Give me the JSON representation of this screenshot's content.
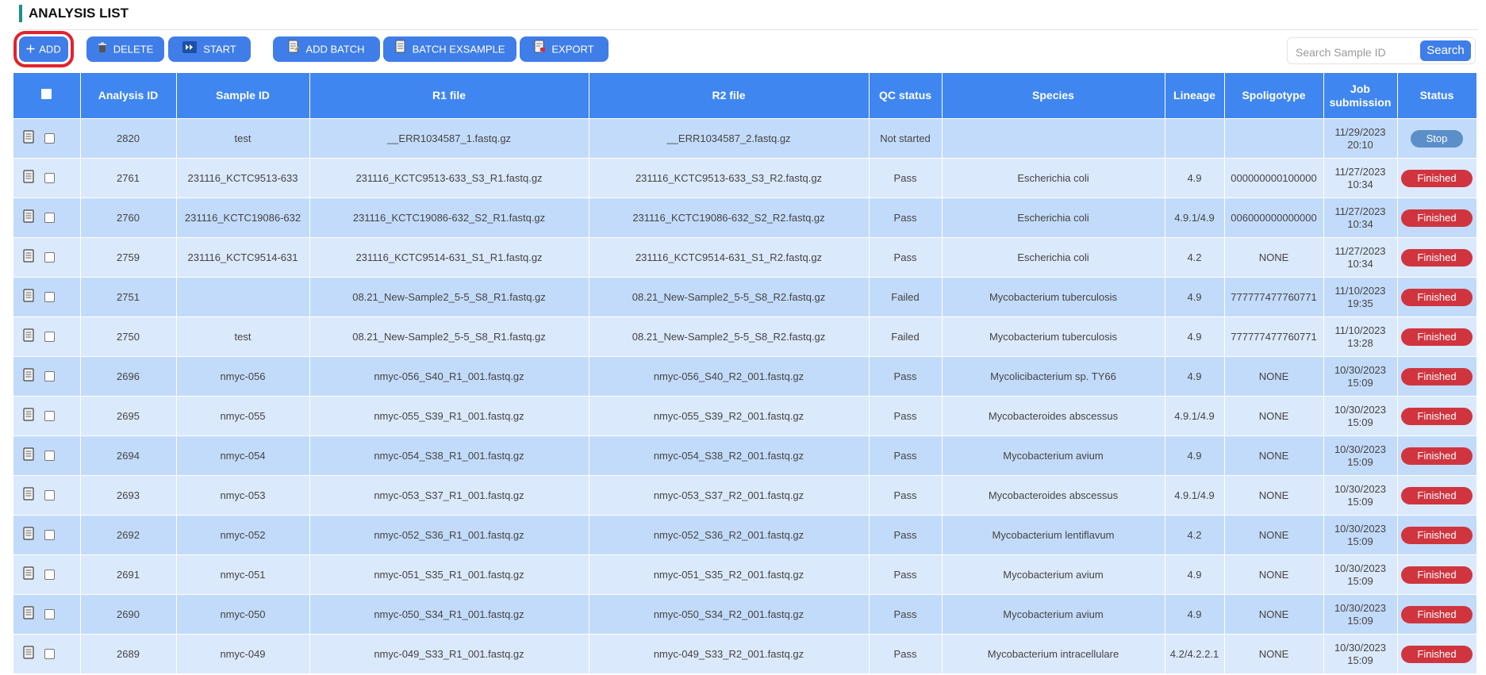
{
  "header": {
    "title": "ANALYSIS LIST"
  },
  "toolbar": {
    "add": "ADD",
    "delete": "DELETE",
    "start": "START",
    "add_batch": "ADD BATCH",
    "batch_example": "BATCH EXSAMPLE",
    "export": "EXPORT"
  },
  "search": {
    "placeholder": "Search Sample ID",
    "button": "Search"
  },
  "table": {
    "columns": [
      "Analysis ID",
      "Sample ID",
      "R1 file",
      "R2 file",
      "QC status",
      "Species",
      "Lineage",
      "Spoligotype",
      "Job submission",
      "Status"
    ],
    "rows": [
      {
        "id": "2820",
        "sample": "test",
        "r1": "__ERR1034587_1.fastq.gz",
        "r2": "__ERR1034587_2.fastq.gz",
        "qc": "Not started",
        "species": "",
        "lineage": "",
        "spoligo": "",
        "date": "11/29/2023",
        "time": "20:10",
        "status": "Stop"
      },
      {
        "id": "2761",
        "sample": "231116_KCTC9513-633",
        "r1": "231116_KCTC9513-633_S3_R1.fastq.gz",
        "r2": "231116_KCTC9513-633_S3_R2.fastq.gz",
        "qc": "Pass",
        "species": "Escherichia coli",
        "lineage": "4.9",
        "spoligo": "000000000100000",
        "date": "11/27/2023",
        "time": "10:34",
        "status": "Finished"
      },
      {
        "id": "2760",
        "sample": "231116_KCTC19086-632",
        "r1": "231116_KCTC19086-632_S2_R1.fastq.gz",
        "r2": "231116_KCTC19086-632_S2_R2.fastq.gz",
        "qc": "Pass",
        "species": "Escherichia coli",
        "lineage": "4.9.1/4.9",
        "spoligo": "006000000000000",
        "date": "11/27/2023",
        "time": "10:34",
        "status": "Finished"
      },
      {
        "id": "2759",
        "sample": "231116_KCTC9514-631",
        "r1": "231116_KCTC9514-631_S1_R1.fastq.gz",
        "r2": "231116_KCTC9514-631_S1_R2.fastq.gz",
        "qc": "Pass",
        "species": "Escherichia coli",
        "lineage": "4.2",
        "spoligo": "NONE",
        "date": "11/27/2023",
        "time": "10:34",
        "status": "Finished"
      },
      {
        "id": "2751",
        "sample": "",
        "r1": "08.21_New-Sample2_5-5_S8_R1.fastq.gz",
        "r2": "08.21_New-Sample2_5-5_S8_R2.fastq.gz",
        "qc": "Failed",
        "species": "Mycobacterium tuberculosis",
        "lineage": "4.9",
        "spoligo": "777777477760771",
        "date": "11/10/2023",
        "time": "19:35",
        "status": "Finished"
      },
      {
        "id": "2750",
        "sample": "test",
        "r1": "08.21_New-Sample2_5-5_S8_R1.fastq.gz",
        "r2": "08.21_New-Sample2_5-5_S8_R2.fastq.gz",
        "qc": "Failed",
        "species": "Mycobacterium tuberculosis",
        "lineage": "4.9",
        "spoligo": "777777477760771",
        "date": "11/10/2023",
        "time": "13:28",
        "status": "Finished"
      },
      {
        "id": "2696",
        "sample": "nmyc-056",
        "r1": "nmyc-056_S40_R1_001.fastq.gz",
        "r2": "nmyc-056_S40_R2_001.fastq.gz",
        "qc": "Pass",
        "species": "Mycolicibacterium sp. TY66",
        "lineage": "4.9",
        "spoligo": "NONE",
        "date": "10/30/2023",
        "time": "15:09",
        "status": "Finished"
      },
      {
        "id": "2695",
        "sample": "nmyc-055",
        "r1": "nmyc-055_S39_R1_001.fastq.gz",
        "r2": "nmyc-055_S39_R2_001.fastq.gz",
        "qc": "Pass",
        "species": "Mycobacteroides abscessus",
        "lineage": "4.9.1/4.9",
        "spoligo": "NONE",
        "date": "10/30/2023",
        "time": "15:09",
        "status": "Finished"
      },
      {
        "id": "2694",
        "sample": "nmyc-054",
        "r1": "nmyc-054_S38_R1_001.fastq.gz",
        "r2": "nmyc-054_S38_R2_001.fastq.gz",
        "qc": "Pass",
        "species": "Mycobacterium avium",
        "lineage": "4.9",
        "spoligo": "NONE",
        "date": "10/30/2023",
        "time": "15:09",
        "status": "Finished"
      },
      {
        "id": "2693",
        "sample": "nmyc-053",
        "r1": "nmyc-053_S37_R1_001.fastq.gz",
        "r2": "nmyc-053_S37_R2_001.fastq.gz",
        "qc": "Pass",
        "species": "Mycobacteroides abscessus",
        "lineage": "4.9.1/4.9",
        "spoligo": "NONE",
        "date": "10/30/2023",
        "time": "15:09",
        "status": "Finished"
      },
      {
        "id": "2692",
        "sample": "nmyc-052",
        "r1": "nmyc-052_S36_R1_001.fastq.gz",
        "r2": "nmyc-052_S36_R2_001.fastq.gz",
        "qc": "Pass",
        "species": "Mycobacterium lentiflavum",
        "lineage": "4.2",
        "spoligo": "NONE",
        "date": "10/30/2023",
        "time": "15:09",
        "status": "Finished"
      },
      {
        "id": "2691",
        "sample": "nmyc-051",
        "r1": "nmyc-051_S35_R1_001.fastq.gz",
        "r2": "nmyc-051_S35_R2_001.fastq.gz",
        "qc": "Pass",
        "species": "Mycobacterium avium",
        "lineage": "4.9",
        "spoligo": "NONE",
        "date": "10/30/2023",
        "time": "15:09",
        "status": "Finished"
      },
      {
        "id": "2690",
        "sample": "nmyc-050",
        "r1": "nmyc-050_S34_R1_001.fastq.gz",
        "r2": "nmyc-050_S34_R2_001.fastq.gz",
        "qc": "Pass",
        "species": "Mycobacterium avium",
        "lineage": "4.9",
        "spoligo": "NONE",
        "date": "10/30/2023",
        "time": "15:09",
        "status": "Finished"
      },
      {
        "id": "2689",
        "sample": "nmyc-049",
        "r1": "nmyc-049_S33_R1_001.fastq.gz",
        "r2": "nmyc-049_S33_R2_001.fastq.gz",
        "qc": "Pass",
        "species": "Mycobacterium intracellulare",
        "lineage": "4.2/4.2.2.1",
        "spoligo": "NONE",
        "date": "10/30/2023",
        "time": "15:09",
        "status": "Finished"
      }
    ]
  },
  "colors": {
    "primary": "#3f7de8",
    "header_bg": "#3f86f0",
    "row_odd": "#c3dbfa",
    "row_even": "#dbe9fc",
    "finished": "#d0353f",
    "stop": "#5b8fc9",
    "highlight": "#e2232f",
    "title_accent": "#1a8f8f"
  },
  "icons": {
    "add": "plus-icon",
    "delete": "trash-icon",
    "start": "fast-forward-icon",
    "add_batch": "document-edit-icon",
    "batch_example": "document-icon",
    "export": "document-export-icon",
    "row": "document-icon"
  }
}
